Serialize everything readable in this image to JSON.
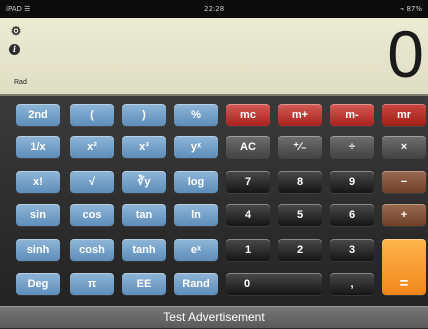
{
  "status": {
    "carrier": "iPAD ☰",
    "time": "22:28",
    "battery": "⌁ 87%"
  },
  "display": {
    "mode": "Rad",
    "value": "0",
    "settings_icon": "gear-icon",
    "info_icon": "info-icon",
    "info_glyph": "i",
    "gear_glyph": "⚙"
  },
  "keys": {
    "row1": [
      "2nd",
      "(",
      ")",
      "%",
      "mc",
      "m+",
      "m-",
      "mr"
    ],
    "row2": [
      "1/x",
      "x²",
      "x³",
      "yˣ",
      "AC",
      "⁺∕₋",
      "÷",
      "×"
    ],
    "row3": [
      "x!",
      "√",
      "∛y",
      "log",
      "7",
      "8",
      "9",
      "−"
    ],
    "row4": [
      "sin",
      "cos",
      "tan",
      "ln",
      "4",
      "5",
      "6",
      "+"
    ],
    "row5": [
      "sinh",
      "cosh",
      "tanh",
      "eˣ",
      "1",
      "2",
      "3"
    ],
    "row6": [
      "Deg",
      "π",
      "EE",
      "Rand",
      "0",
      ","
    ],
    "equals": "="
  },
  "ad": {
    "text": "Test Advertisement"
  },
  "colors": {
    "sci": "#6f9cc6",
    "memory": "#b8302a",
    "operator_brown": "#7e5035",
    "equals": "#f59a2d",
    "display_bg": "#e6e5cb"
  }
}
